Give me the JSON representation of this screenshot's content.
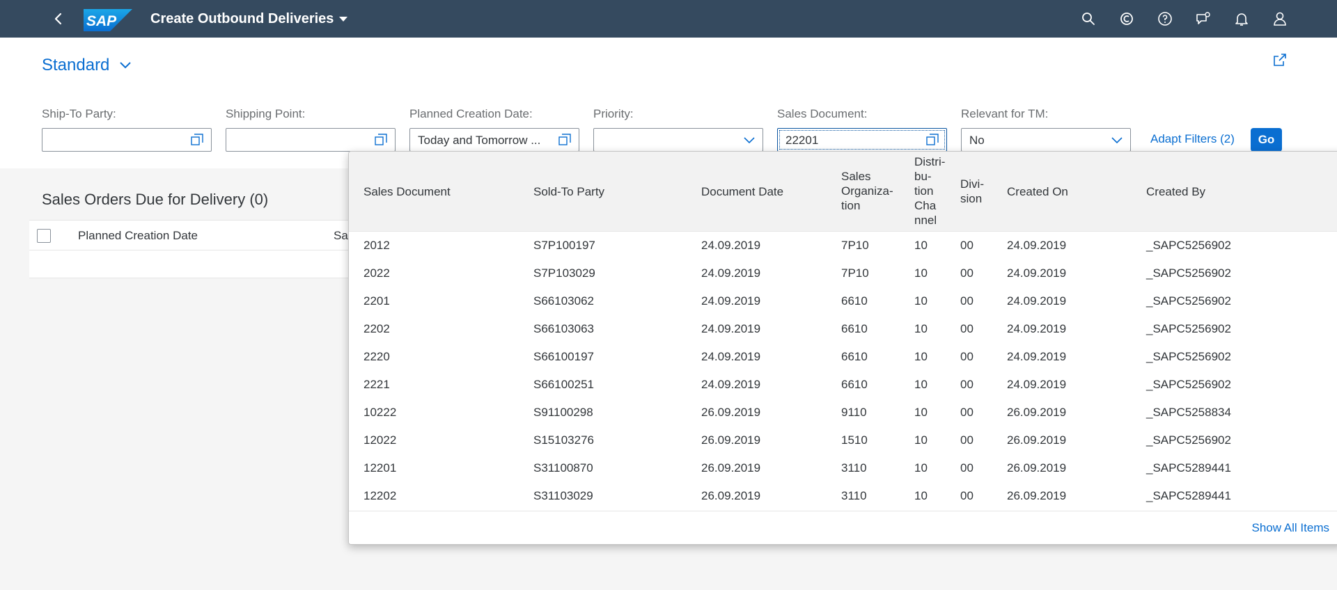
{
  "shell": {
    "title": "Create Outbound Deliveries",
    "icons": [
      "back-icon",
      "sap-logo",
      "search-icon",
      "copilot-icon",
      "help-icon",
      "feedback-icon",
      "notifications-icon",
      "user-icon"
    ]
  },
  "header": {
    "variant": "Standard",
    "filters": [
      {
        "label": "Ship-To Party:",
        "value": "",
        "control": "value-help"
      },
      {
        "label": "Shipping Point:",
        "value": "",
        "control": "value-help"
      },
      {
        "label": "Planned Creation Date:",
        "value": "Today and Tomorrow ...",
        "control": "value-help"
      },
      {
        "label": "Priority:",
        "value": "",
        "control": "dropdown"
      },
      {
        "label": "Sales Document:",
        "value": "22201",
        "control": "value-help"
      },
      {
        "label": "Relevant for TM:",
        "value": "No",
        "control": "dropdown"
      }
    ],
    "adapt_filters": "Adapt Filters (2)",
    "go": "Go"
  },
  "content": {
    "table_title": "Sales Orders Due for Delivery (0)",
    "col1": "Planned Creation Date",
    "col2": "Sa"
  },
  "suggestions": {
    "headers": [
      "Sales Document",
      "Sold-To Party",
      "Document Date",
      "Sales\nOrganiza-\ntion",
      "Distri-\nbu-\ntion\nCha\nnnel",
      "Divi-\nsion",
      "Created On",
      "Created By"
    ],
    "rows": [
      [
        "2012",
        "S7P100197",
        "24.09.2019",
        "7P10",
        "10",
        "00",
        "24.09.2019",
        "_SAPC5256902"
      ],
      [
        "2022",
        "S7P103029",
        "24.09.2019",
        "7P10",
        "10",
        "00",
        "24.09.2019",
        "_SAPC5256902"
      ],
      [
        "2201",
        "S66103062",
        "24.09.2019",
        "6610",
        "10",
        "00",
        "24.09.2019",
        "_SAPC5256902"
      ],
      [
        "2202",
        "S66103063",
        "24.09.2019",
        "6610",
        "10",
        "00",
        "24.09.2019",
        "_SAPC5256902"
      ],
      [
        "2220",
        "S66100197",
        "24.09.2019",
        "6610",
        "10",
        "00",
        "24.09.2019",
        "_SAPC5256902"
      ],
      [
        "2221",
        "S66100251",
        "24.09.2019",
        "6610",
        "10",
        "00",
        "24.09.2019",
        "_SAPC5256902"
      ],
      [
        "10222",
        "S91100298",
        "26.09.2019",
        "9110",
        "10",
        "00",
        "26.09.2019",
        "_SAPC5258834"
      ],
      [
        "12022",
        "S15103276",
        "26.09.2019",
        "1510",
        "10",
        "00",
        "26.09.2019",
        "_SAPC5256902"
      ],
      [
        "12201",
        "S31100870",
        "26.09.2019",
        "3110",
        "10",
        "00",
        "26.09.2019",
        "_SAPC5289441"
      ],
      [
        "12202",
        "S31103029",
        "26.09.2019",
        "3110",
        "10",
        "00",
        "26.09.2019",
        "_SAPC5289441"
      ]
    ],
    "show_all": "Show All Items"
  },
  "colors": {
    "shell": "#354a5f",
    "accent": "#0a6ed1",
    "text": "#32363a",
    "label": "#6a6d70"
  }
}
